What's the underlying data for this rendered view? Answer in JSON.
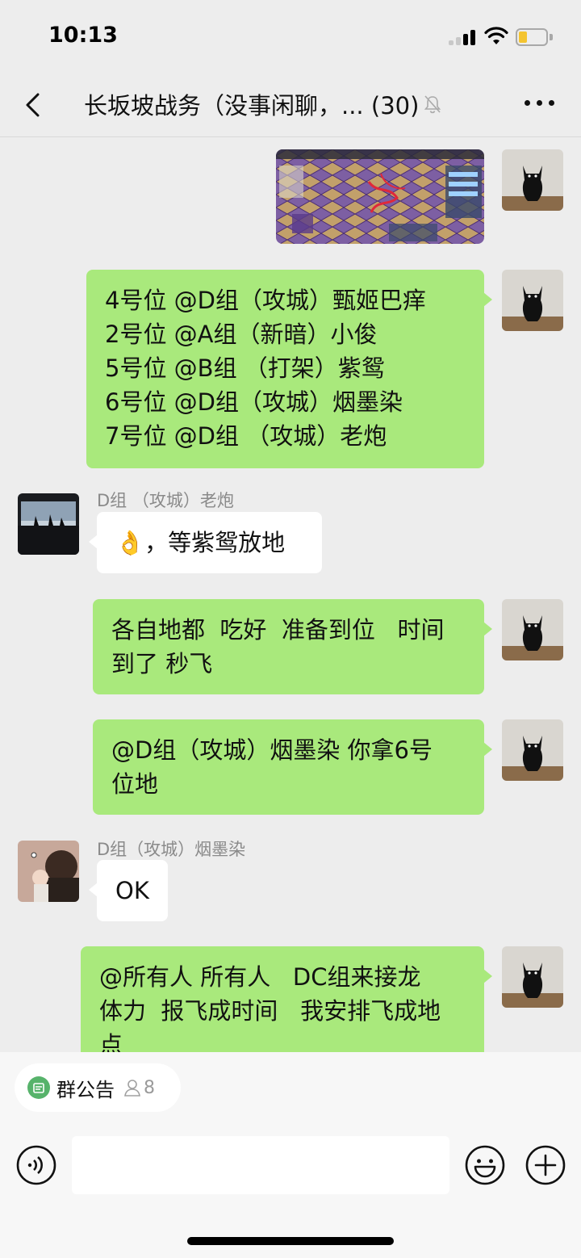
{
  "status": {
    "time": "10:13"
  },
  "header": {
    "title": "长坂坡战务（没事闲聊，... (30)"
  },
  "messages": {
    "m2": {
      "text": "4号位 @D组（攻城）甄姬巴痒\n2号位 @A组（新暗）小俊\n5号位 @B组 （打架）紫鸳\n6号位 @D组（攻城）烟墨染\n7号位 @D组 （攻城）老炮"
    },
    "m3": {
      "sender": "D组 （攻城）老炮",
      "text": "👌，等紫鸳放地"
    },
    "m4": {
      "text": "各自地都  吃好  准备到位   时间\n到了 秒飞"
    },
    "m5": {
      "text": "@D组（攻城）烟墨染 你拿6号\n位地"
    },
    "m6": {
      "sender": "D组（攻城）烟墨染",
      "text": "OK"
    },
    "m7": {
      "text": "@所有人 所有人   DC组来接龙\n体力  报飞成时间   我安排飞成地\n点"
    }
  },
  "announcement": {
    "label": "群公告",
    "count": "8"
  },
  "input": {
    "value": ""
  },
  "colors": {
    "bubble_green": "#a9e97c",
    "bubble_white": "#ffffff",
    "bg": "#ededed"
  }
}
